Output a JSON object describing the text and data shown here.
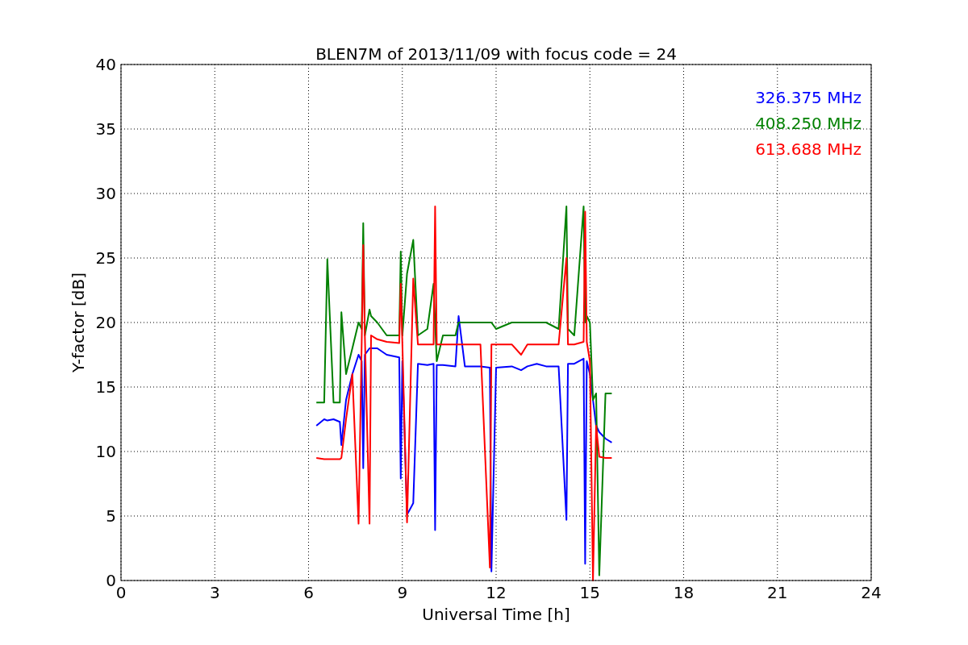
{
  "chart_data": {
    "type": "line",
    "title": "BLEN7M of 2013/11/09 with focus code = 24",
    "xlabel": "Universal Time [h]",
    "ylabel": "Y-factor [dB]",
    "x": [
      6.25,
      6.5,
      6.6,
      6.8,
      7.0,
      7.05,
      7.2,
      7.4,
      7.6,
      7.7,
      7.75,
      7.8,
      7.95,
      8.0,
      8.2,
      8.5,
      8.9,
      8.95,
      9.0,
      9.15,
      9.35,
      9.5,
      9.8,
      10.0,
      10.05,
      10.1,
      10.3,
      10.7,
      10.8,
      11.0,
      11.5,
      11.8,
      11.85,
      12.0,
      12.5,
      12.8,
      13.0,
      13.3,
      13.6,
      14.0,
      14.25,
      14.3,
      14.5,
      14.8,
      14.85,
      14.9,
      15.0,
      15.1,
      15.2,
      15.3,
      15.5,
      15.7
    ],
    "grid": true,
    "xlim": [
      0,
      24
    ],
    "ylim": [
      0,
      40
    ],
    "xticks": [
      0,
      3,
      6,
      9,
      12,
      15,
      18,
      21,
      24
    ],
    "yticks": [
      0,
      5,
      10,
      15,
      20,
      25,
      30,
      35,
      40
    ],
    "series": [
      {
        "name": "326.375 MHz",
        "color": "#0000ff",
        "values": [
          12,
          12.5,
          12.4,
          12.5,
          12.3,
          10.5,
          14,
          16,
          17.5,
          17,
          8.7,
          17.5,
          18,
          18,
          18,
          17.5,
          17.3,
          7.9,
          17,
          5.1,
          6,
          16.8,
          16.7,
          16.8,
          3.9,
          16.7,
          16.7,
          16.6,
          20.5,
          16.6,
          16.6,
          16.5,
          0.7,
          16.5,
          16.6,
          16.3,
          16.6,
          16.8,
          16.6,
          16.6,
          4.7,
          16.8,
          16.8,
          17.2,
          1.3,
          17,
          16,
          14,
          12,
          11.5,
          11,
          10.7
        ]
      },
      {
        "name": "408.250 MHz",
        "color": "#008000",
        "values": [
          13.8,
          13.8,
          24.9,
          13.8,
          13.8,
          20.8,
          16,
          18,
          20,
          19.5,
          27.7,
          19,
          21,
          20.5,
          20,
          19,
          19,
          25.5,
          19,
          23.8,
          26.4,
          19,
          19.5,
          23,
          20,
          17,
          19,
          19,
          20,
          20,
          20,
          20,
          20,
          19.5,
          20,
          20,
          20,
          20,
          20,
          19.5,
          29,
          19.5,
          19,
          29,
          20,
          20.5,
          20,
          14,
          14.5,
          0.4,
          14.5,
          14.5
        ]
      },
      {
        "name": "613.688 MHz",
        "color": "#ff0000",
        "values": [
          9.5,
          9.4,
          9.4,
          9.4,
          9.4,
          9.5,
          12.5,
          16,
          4.4,
          18.5,
          26,
          19,
          4.4,
          19,
          18.7,
          18.5,
          18.4,
          23,
          18.4,
          4.5,
          23.4,
          18.3,
          18.3,
          18.3,
          29,
          18.3,
          18.3,
          18.3,
          18.3,
          18.3,
          18.3,
          1,
          18.3,
          18.3,
          18.3,
          17.5,
          18.3,
          18.3,
          18.3,
          18.3,
          25,
          18.3,
          18.3,
          18.5,
          28.6,
          18.5,
          17,
          0,
          12,
          9.6,
          9.5,
          9.5
        ]
      }
    ]
  }
}
